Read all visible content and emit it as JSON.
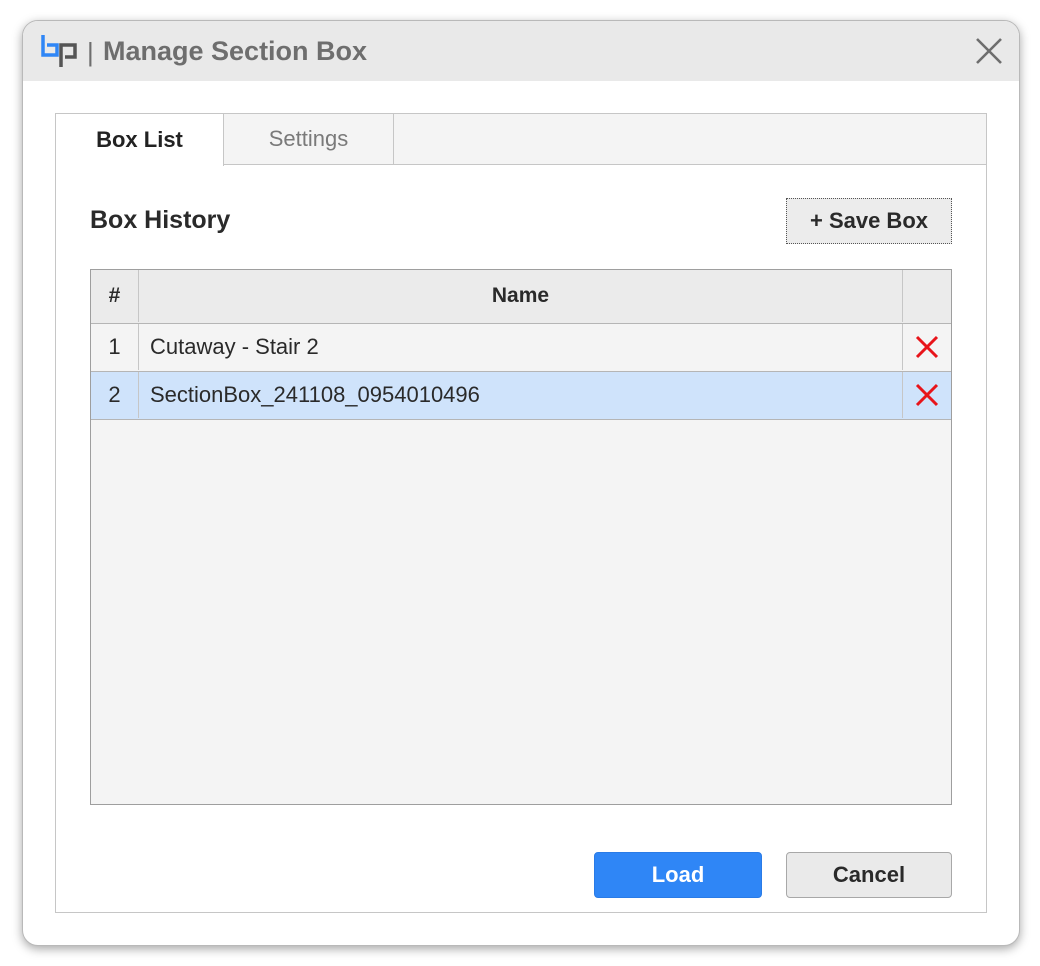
{
  "window": {
    "title_separator": "|",
    "title": "Manage Section Box",
    "logo_icon": "bp-logo-icon",
    "close_icon": "close-icon"
  },
  "tabs": [
    {
      "label": "Box List",
      "active": true
    },
    {
      "label": "Settings",
      "active": false
    }
  ],
  "box_list": {
    "heading": "Box History",
    "save_button_label": "+ Save Box",
    "table": {
      "columns": [
        "#",
        "Name",
        ""
      ],
      "rows": [
        {
          "num": "1",
          "name": "Cutaway - Stair 2",
          "selected": false
        },
        {
          "num": "2",
          "name": "SectionBox_241108_0954010496",
          "selected": true
        }
      ],
      "delete_icon": "delete-x-icon"
    }
  },
  "footer": {
    "load_label": "Load",
    "cancel_label": "Cancel"
  },
  "colors": {
    "accent": "#2f86f6",
    "selected_row": "#cfe3fb",
    "delete_red": "#e8141a",
    "logo_blue": "#2f86f6",
    "logo_gray": "#6e6e6e"
  }
}
